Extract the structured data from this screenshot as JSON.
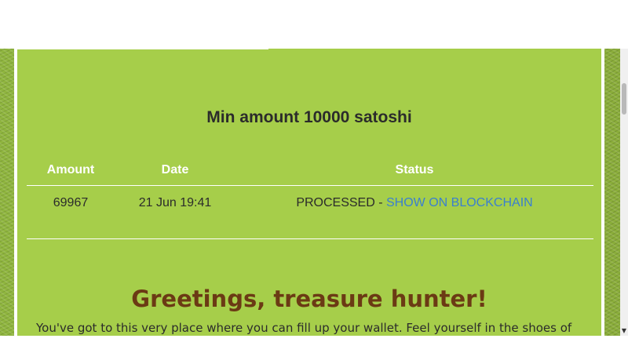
{
  "min_amount_text": "Min amount 10000 satoshi",
  "payouts": {
    "headers": {
      "amount": "Amount",
      "date": "Date",
      "status": "Status"
    },
    "rows": [
      {
        "amount": "69967",
        "date": "21 Jun 19:41",
        "status": "PROCESSED - ",
        "link": "SHOW ON BLOCKCHAIN"
      }
    ]
  },
  "greeting": "Greetings, treasure hunter!",
  "intro": "You've got to this very place where you can fill up your wallet. Feel yourself in the shoes of",
  "colors": {
    "panel": "#a6ce4a",
    "heading": "#6b3a14",
    "link": "#3a7fd0"
  },
  "icons": {
    "scroll_down": "chevron-down-icon"
  }
}
